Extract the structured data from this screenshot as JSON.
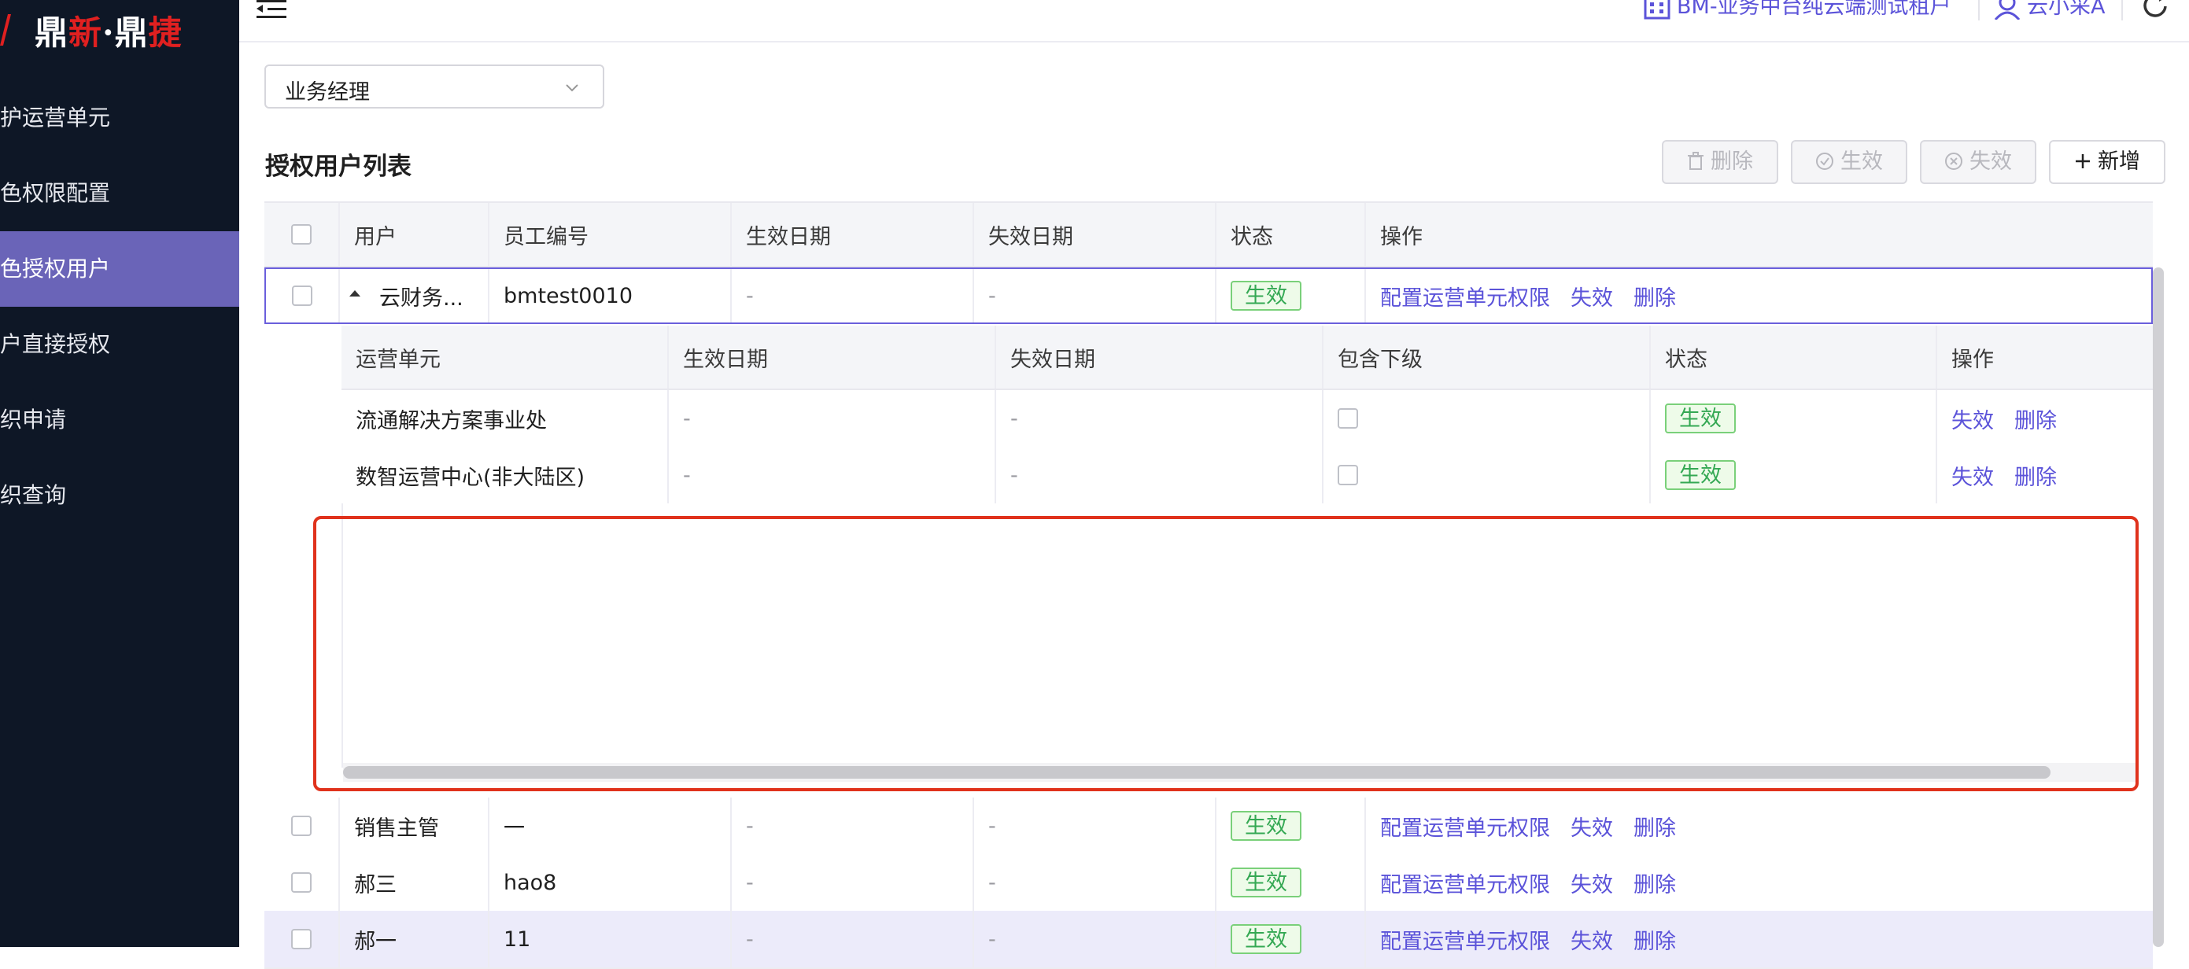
{
  "app": {
    "logo_part1": "鼎",
    "logo_part2": "新",
    "logo_part3": "·鼎",
    "logo_part4": "捷"
  },
  "sidebar": {
    "items": [
      {
        "label": "维护运营单元",
        "active": false
      },
      {
        "label": "角色权限配置",
        "active": false
      },
      {
        "label": "角色授权用户",
        "active": true
      },
      {
        "label": "用户直接授权",
        "active": false
      },
      {
        "label": "组织申请",
        "active": false
      },
      {
        "label": "组织查询",
        "active": false
      }
    ]
  },
  "header": {
    "tenant": "BM-业务中台纯云端测试租户",
    "user": "云小采A"
  },
  "filter": {
    "role_value": "业务经理"
  },
  "list": {
    "title": "授权用户列表",
    "buttons": {
      "delete": "删除",
      "activate": "生效",
      "deactivate": "失效",
      "add": "新增"
    },
    "columns": [
      "用户",
      "员工编号",
      "生效日期",
      "失效日期",
      "状态",
      "操作"
    ],
    "rows": [
      {
        "user": "云财务...",
        "emp_no": "bmtest0010",
        "start": "-",
        "end": "-",
        "status": "生效",
        "actions": [
          "配置运营单元权限",
          "失效",
          "删除"
        ]
      },
      {
        "user": "销售主管",
        "emp_no": "一",
        "start": "-",
        "end": "-",
        "status": "生效",
        "actions": [
          "配置运营单元权限",
          "失效",
          "删除"
        ]
      },
      {
        "user": "郝三",
        "emp_no": "hao8",
        "start": "-",
        "end": "-",
        "status": "生效",
        "actions": [
          "配置运营单元权限",
          "失效",
          "删除"
        ]
      },
      {
        "user": "郝一",
        "emp_no": "11",
        "start": "-",
        "end": "-",
        "status": "生效",
        "actions": [
          "配置运营单元权限",
          "失效",
          "删除"
        ]
      }
    ]
  },
  "sublist": {
    "columns": [
      "运营单元",
      "生效日期",
      "失效日期",
      "包含下级",
      "状态",
      "操作"
    ],
    "rows": [
      {
        "unit": "流通解决方案事业处",
        "start": "-",
        "end": "-",
        "status": "生效",
        "actions": [
          "失效",
          "删除"
        ]
      },
      {
        "unit": "数智运营中心(非大陆区)",
        "start": "-",
        "end": "-",
        "status": "生效",
        "actions": [
          "失效",
          "删除"
        ]
      }
    ]
  },
  "colors": {
    "sidebar_bg": "#0e1726",
    "active_item": "#6a64b8",
    "link": "#5b53d9",
    "status_green": "#34a853",
    "highlight_box": "#e0321c"
  }
}
